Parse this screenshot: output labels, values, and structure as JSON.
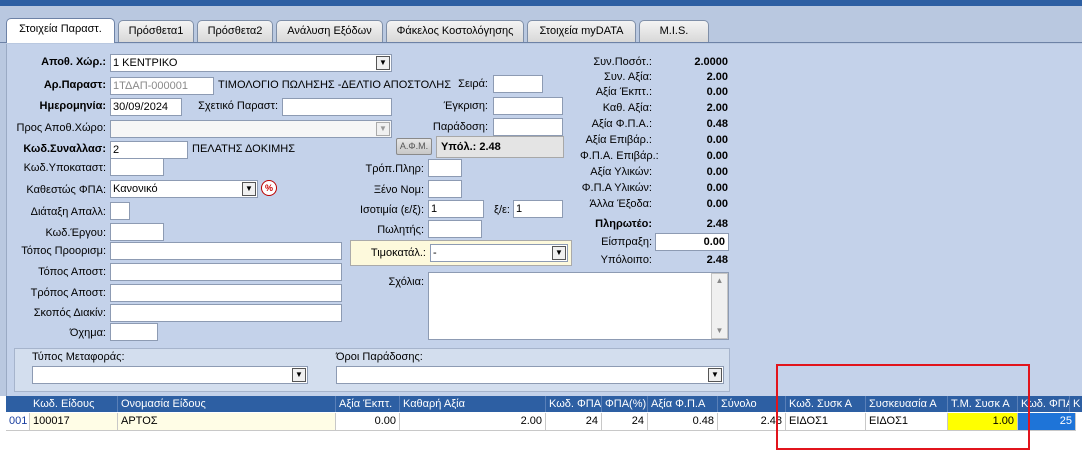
{
  "tabs": [
    "Στοιχεία Παραστ.",
    "Πρόσθετα1",
    "Πρόσθετα2",
    "Ανάλυση Εξόδων",
    "Φάκελος Κοστολόγησης",
    "Στοιχεία myDATA",
    "M.I.S."
  ],
  "form": {
    "warehouse_label": "Αποθ. Χώρ.:",
    "warehouse_value": "1 ΚΕΝΤΡΙΚΟ",
    "docno_label": "Αρ.Παραστ:",
    "docno_value": "1ΤΔΑΠ-000001",
    "doctype": "ΤΙΜΟΛΟΓΙΟ ΠΩΛΗΣΗΣ -ΔΕΛΤΙΟ ΑΠΟΣΤΟΛΗΣ",
    "date_label": "Ημερομηνία:",
    "date_value": "30/09/2024",
    "related_label": "Σχετικό Παραστ:",
    "to_wh_label": "Προς Αποθ.Χώρο:",
    "trader_label": "Κωδ.Συναλλασ:",
    "trader_value": "2",
    "trader_name": "ΠΕΛΑΤΗΣ ΔΟΚΙΜΗΣ",
    "afm_button": "Α.Φ.Μ.",
    "balance_text": "Υπόλ.: 2.48",
    "branch_label": "Κωδ.Υποκαταστ:",
    "vat_status_label": "Καθεστώς ΦΠΑ:",
    "vat_status_value": "Κανονικό",
    "exemption_label": "Διάταξη Απαλλ:",
    "project_label": "Κωδ.Έργου:",
    "destination_label": "Τόπος Προορισμ:",
    "dispatch_place_label": "Τόπος Αποστ:",
    "dispatch_method_label": "Τρόπος Αποστ:",
    "purpose_label": "Σκοπός Διακίν:",
    "vehicle_label": "Όχημα:",
    "series_label": "Σειρά:",
    "approval_label": "Έγκριση:",
    "delivery_label": "Παράδοση:",
    "payment_label": "Τρόπ.Πληρ:",
    "currency_label": "Ξένο Νομ:",
    "parity_label": "Ισοτιμία (ε/ξ):",
    "parity_value": "1",
    "xe_label": "ξ/ε:",
    "xe_value": "1",
    "seller_label": "Πωλητής:",
    "pricelist_label": "Τιμοκατάλ.:",
    "pricelist_value": "-",
    "comments_label": "Σχόλια:",
    "transport_type_label": "Τύπος Μεταφοράς:",
    "delivery_terms_label": "Όροι Παράδοσης:"
  },
  "summary": [
    {
      "label": "Συν.Ποσότ.:",
      "value": "2.0000"
    },
    {
      "label": "Συν. Αξία:",
      "value": "2.00"
    },
    {
      "label": "Αξία Έκπτ.:",
      "value": "0.00"
    },
    {
      "label": "Καθ. Αξία:",
      "value": "2.00"
    },
    {
      "label": "Αξία Φ.Π.Α.:",
      "value": "0.48"
    },
    {
      "label": "Αξία Επιβάρ.:",
      "value": "0.00"
    },
    {
      "label": "Φ.Π.Α. Επιβάρ.:",
      "value": "0.00"
    },
    {
      "label": "Αξία Υλικών:",
      "value": "0.00"
    },
    {
      "label": "Φ.Π.Α Υλικών:",
      "value": "0.00"
    },
    {
      "label": "Άλλα Έξοδα:",
      "value": "0.00"
    },
    {
      "label": "Πληρωτέο:",
      "value": "2.48"
    },
    {
      "label": "Είσπραξη:",
      "value": "0.00"
    },
    {
      "label": "Υπόλοιπο:",
      "value": "2.48"
    }
  ],
  "grid": {
    "headers": [
      "Κωδ. Είδους",
      "Ονομασία Είδους",
      "Αξία Έκπτ.",
      "Καθαρή Αξία",
      "Κωδ. ΦΠΑ",
      "ΦΠΑ(%)",
      "Αξία Φ.Π.Α",
      "Σύνολο",
      "Κωδ. Συσκ Α",
      "Συσκευασία Α",
      "Τ.Μ. Συσκ Α",
      "Κωδ. ΦΠΑ",
      "Κ"
    ],
    "row": {
      "line": "001",
      "code": "100017",
      "name": "ΑΡΤΟΣ",
      "discount": "0.00",
      "net": "2.00",
      "vat_code": "24",
      "vat_pct": "24",
      "vat_value": "0.48",
      "total": "2.48",
      "pack_code": "ΕΙΔΟΣ1",
      "pack": "ΕΙΔΟΣ1",
      "pack_price": "1.00",
      "vat_code2": "25"
    }
  },
  "colors": {
    "header_blue": "#2d5fa3",
    "highlight_yellow": "#ffff00",
    "annotation_red": "#e2141c"
  }
}
